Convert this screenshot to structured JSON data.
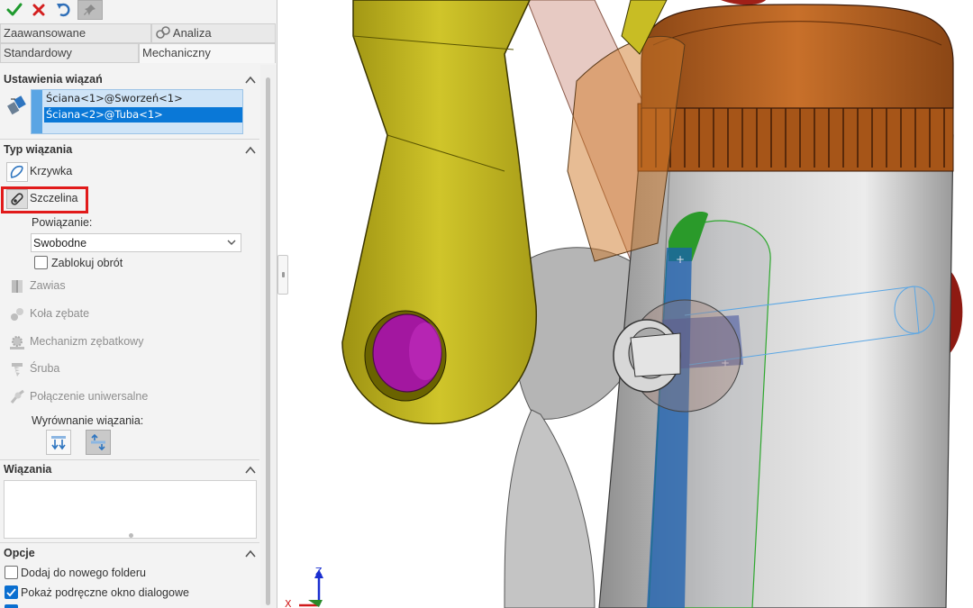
{
  "toolbar": {
    "ok_icon": "check-icon",
    "cancel_icon": "close-icon",
    "undo_icon": "undo-icon",
    "pin_icon": "pushpin-icon"
  },
  "tabs": {
    "row1": [
      {
        "label": "Zaawansowane"
      },
      {
        "label": "Analiza",
        "icon": "analysis-icon"
      }
    ],
    "row2": [
      {
        "label": "Standardowy"
      },
      {
        "label": "Mechaniczny",
        "active": true
      }
    ]
  },
  "mate_settings": {
    "title": "Ustawienia wiązań",
    "selections": [
      "Ściana<1>@Sworzeń<1>",
      "Ściana<2>@Tuba<1>"
    ],
    "selected_index": 1
  },
  "mate_type": {
    "title": "Typ wiązania",
    "items": [
      {
        "label": "Krzywka",
        "icon": "cam-icon",
        "enabled": true
      },
      {
        "label": "Szczelina",
        "icon": "slot-icon",
        "enabled": true,
        "selected": true
      },
      {
        "label": "Zawias",
        "icon": "hinge-icon",
        "enabled": false
      },
      {
        "label": "Koła zębate",
        "icon": "gear-icon",
        "enabled": false
      },
      {
        "label": "Mechanizm zębatkowy",
        "icon": "rack-pinion-icon",
        "enabled": false
      },
      {
        "label": "Śruba",
        "icon": "screw-icon",
        "enabled": false
      },
      {
        "label": "Połączenie uniwersalne",
        "icon": "universal-joint-icon",
        "enabled": false
      }
    ],
    "constraint_label": "Powiązanie:",
    "constraint_value": "Swobodne",
    "lock_rotation_label": "Zablokuj obrót",
    "lock_rotation_checked": false,
    "alignment_label": "Wyrównanie wiązania:"
  },
  "mates": {
    "title": "Wiązania"
  },
  "options": {
    "title": "Opcje",
    "items": [
      {
        "label": "Dodaj do nowego folderu",
        "checked": false
      },
      {
        "label": "Pokaż podręczne okno dialogowe",
        "checked": true
      }
    ]
  },
  "triad": {
    "z": "Z",
    "x": "X"
  },
  "colors": {
    "selection": "#0a78d7",
    "highlight_frame": "#e11a1a",
    "link_yellow": "#c3b81f",
    "pin_magenta": "#b21aa8",
    "cap_orange": "#b8601e"
  }
}
